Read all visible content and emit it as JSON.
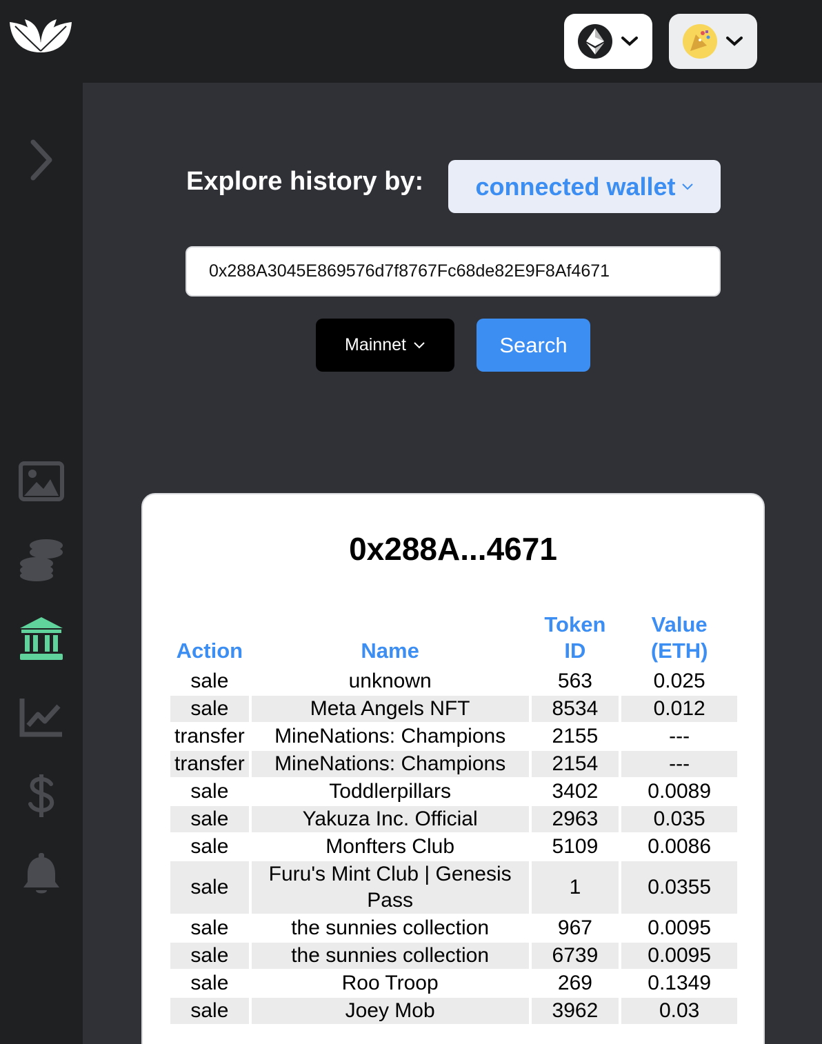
{
  "header": {
    "network_icon": "ethereum-icon",
    "avatar_icon": "party-emoji-avatar"
  },
  "sidebar": {
    "items": [
      {
        "name": "expand",
        "icon": "chevron-right-icon"
      },
      {
        "name": "gallery",
        "icon": "image-icon"
      },
      {
        "name": "tokens",
        "icon": "coins-icon"
      },
      {
        "name": "history",
        "icon": "bank-icon",
        "active": true
      },
      {
        "name": "analytics",
        "icon": "chart-line-icon"
      },
      {
        "name": "price",
        "icon": "dollar-icon"
      },
      {
        "name": "alerts",
        "icon": "bell-icon"
      }
    ]
  },
  "explore": {
    "label": "Explore history by:",
    "mode": "connected wallet",
    "address": "0x288A3045E869576d7f8767Fc68de82E9F8Af4671",
    "network": "Mainnet",
    "search_label": "Search"
  },
  "result": {
    "title": "0x288A...4671",
    "columns": [
      "Action",
      "Name",
      "Token ID",
      "Value (ETH)"
    ],
    "rows": [
      {
        "action": "sale",
        "name": "unknown",
        "token_id": "563",
        "value": "0.025"
      },
      {
        "action": "sale",
        "name": "Meta Angels NFT",
        "token_id": "8534",
        "value": "0.012"
      },
      {
        "action": "transfer",
        "name": "MineNations: Champions",
        "token_id": "2155",
        "value": "---"
      },
      {
        "action": "transfer",
        "name": "MineNations: Champions",
        "token_id": "2154",
        "value": "---"
      },
      {
        "action": "sale",
        "name": "Toddlerpillars",
        "token_id": "3402",
        "value": "0.0089"
      },
      {
        "action": "sale",
        "name": "Yakuza Inc. Official",
        "token_id": "2963",
        "value": "0.035"
      },
      {
        "action": "sale",
        "name": "Monfters Club",
        "token_id": "5109",
        "value": "0.0086"
      },
      {
        "action": "sale",
        "name": "Furu's Mint Club | Genesis Pass",
        "token_id": "1",
        "value": "0.0355"
      },
      {
        "action": "sale",
        "name": "the sunnies collection",
        "token_id": "967",
        "value": "0.0095"
      },
      {
        "action": "sale",
        "name": "the sunnies collection",
        "token_id": "6739",
        "value": "0.0095"
      },
      {
        "action": "sale",
        "name": "Roo Troop",
        "token_id": "269",
        "value": "0.1349"
      },
      {
        "action": "sale",
        "name": "Joey Mob",
        "token_id": "3962",
        "value": "0.03"
      }
    ]
  },
  "colors": {
    "accent": "#3d8ef2",
    "active_sidebar": "#5fd39b",
    "main_bg": "#303136",
    "sidebar_bg": "#1f2022"
  }
}
